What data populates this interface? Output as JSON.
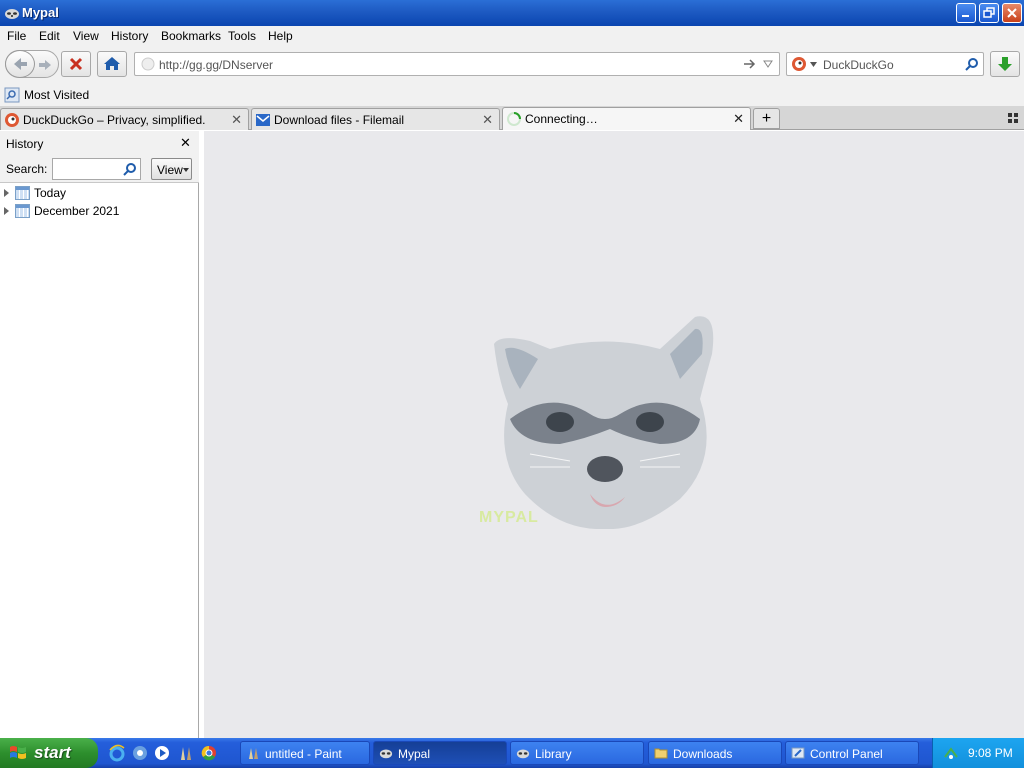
{
  "window": {
    "title": "Mypal"
  },
  "menu": {
    "items": [
      "File",
      "Edit",
      "View",
      "History",
      "Bookmarks",
      "Tools",
      "Help"
    ]
  },
  "navbar": {
    "url": "http://gg.gg/DNserver",
    "search_engine": "DuckDuckGo"
  },
  "bookmarks": {
    "most_visited": "Most Visited"
  },
  "tabs": [
    {
      "label": "DuckDuckGo – Privacy, simplified.",
      "icon": "duckduckgo-icon",
      "active": false
    },
    {
      "label": "Download files - Filemail",
      "icon": "filemail-icon",
      "active": false
    },
    {
      "label": "Connecting…",
      "icon": "loading-spinner-icon",
      "active": true
    }
  ],
  "sidebar": {
    "title": "History",
    "search_label": "Search:",
    "view_label": "View",
    "items": [
      {
        "label": "Today"
      },
      {
        "label": "December 2021"
      }
    ]
  },
  "content": {
    "watermark_text": "MYPAL"
  },
  "taskbar": {
    "start_label": "start",
    "tasks": [
      {
        "label": "untitled - Paint",
        "active": false
      },
      {
        "label": "Mypal",
        "active": true
      },
      {
        "label": "Library",
        "active": false
      },
      {
        "label": "Downloads",
        "active": false
      },
      {
        "label": "Control Panel",
        "active": false
      }
    ],
    "clock": "9:08 PM"
  },
  "colors": {
    "titlebar": "#1f5cc4",
    "taskbar": "#245edb",
    "start": "#2d8f2d",
    "content_bg": "#e9e9ec"
  }
}
